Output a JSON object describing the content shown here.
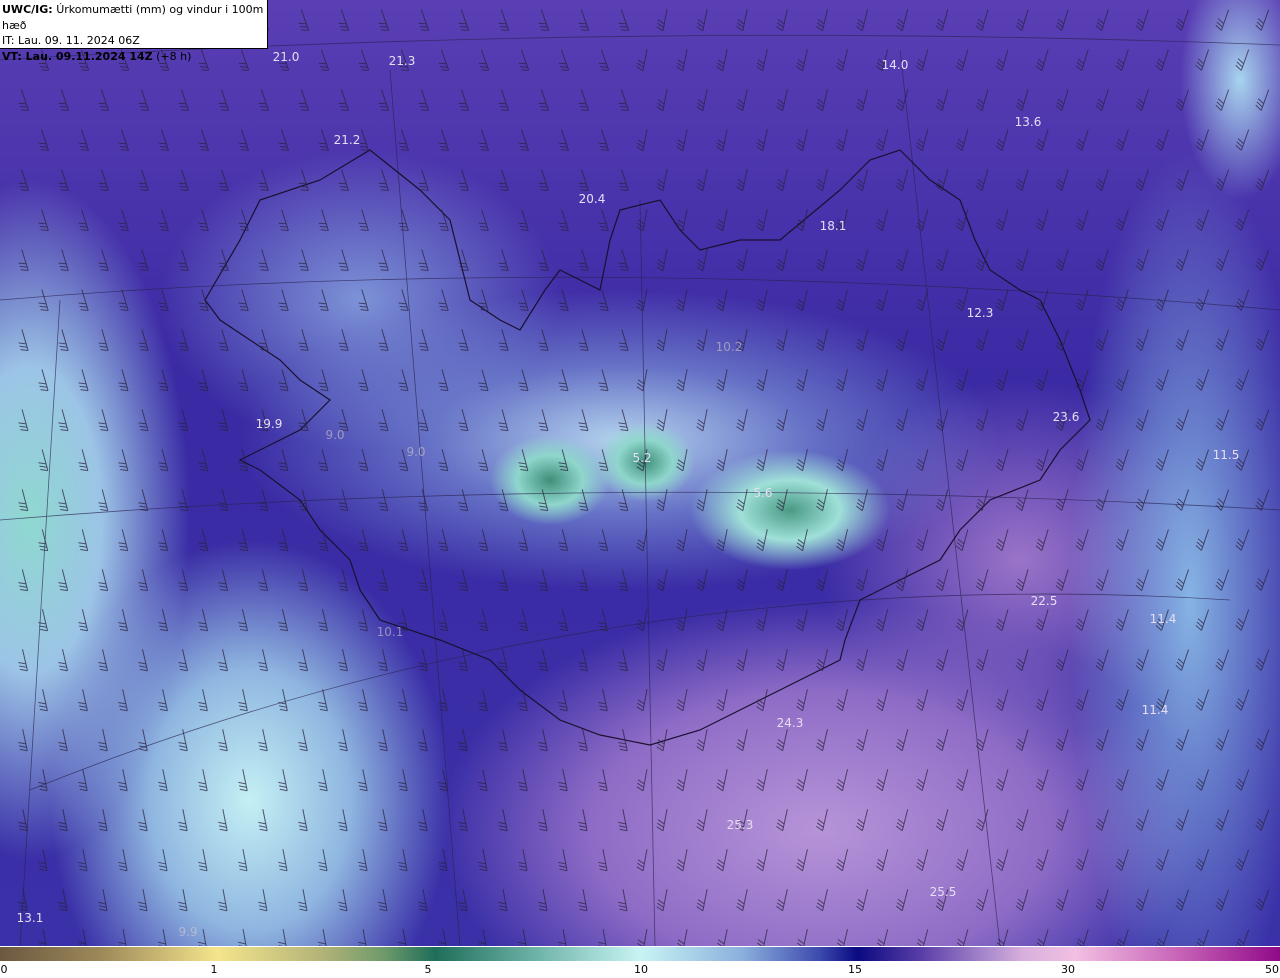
{
  "header": {
    "model": "UWC/IG:",
    "title": "Úrkomumætti (mm) og vindur i 100m hæð",
    "initial_time": "IT: Lau. 09. 11. 2024 06Z",
    "valid_time_bold": "VT: Lau. 09.11.2024 14Z",
    "lead": "(+8 h)"
  },
  "map": {
    "variable": "precipitable water (mm)",
    "overlay": "wind barbs at 100m",
    "labels": [
      "21.0",
      "21.3",
      "14.0",
      "13.6",
      "21.2",
      "20.4",
      "18.1",
      "12.3",
      "23.6",
      "19.9",
      "9.0",
      "9.0",
      "10.2",
      "5.2",
      "11.5",
      "5.6",
      "22.5",
      "11.4",
      "10.1",
      "11.4",
      "24.3",
      "25.3",
      "25.5",
      "13.1",
      "9.9"
    ]
  },
  "colorbar": {
    "ticks": [
      "0",
      "1",
      "5",
      "10",
      "15",
      "30",
      "50"
    ],
    "colors": [
      "#6b5840",
      "#f4e58c",
      "#1f6e5a",
      "#c8f4f4",
      "#0a0a80",
      "#f2c0e2",
      "#900a88"
    ]
  }
}
